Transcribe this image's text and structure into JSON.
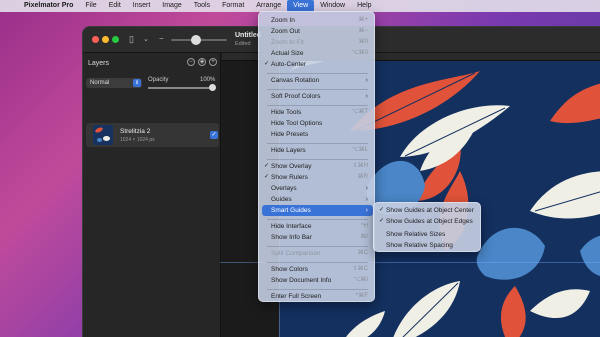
{
  "menubar": {
    "items": [
      "Pixelmator Pro",
      "File",
      "Edit",
      "Insert",
      "Image",
      "Tools",
      "Format",
      "Arrange",
      "View",
      "Window",
      "Help"
    ],
    "active": "View"
  },
  "window": {
    "doc_title": "Untitled",
    "doc_subtitle": "Edited"
  },
  "layers_panel": {
    "title": "Layers",
    "blend_mode": "Normal",
    "opacity_label": "Opacity",
    "opacity_value": "100%",
    "layer": {
      "name": "Strelitzia 2",
      "size": "1024 × 1024 px",
      "visible": true
    }
  },
  "view_menu": {
    "zoom_in": {
      "label": "Zoom In",
      "shortcut": "⌘+"
    },
    "zoom_out": {
      "label": "Zoom Out",
      "shortcut": "⌘−"
    },
    "zoom_to_fit": {
      "label": "Zoom to Fit",
      "shortcut": "⌘0"
    },
    "actual_size": {
      "label": "Actual Size",
      "shortcut": "⌥⌘0"
    },
    "auto_center": {
      "label": "Auto-Center",
      "checked": true
    },
    "canvas_rotation": {
      "label": "Canvas Rotation"
    },
    "soft_proof_colors": {
      "label": "Soft Proof Colors"
    },
    "hide_tools": {
      "label": "Hide Tools",
      "shortcut": "⌥⌘T"
    },
    "hide_tool_options": {
      "label": "Hide Tool Options"
    },
    "hide_presets": {
      "label": "Hide Presets"
    },
    "hide_layers": {
      "label": "Hide Layers",
      "shortcut": "⌥⌘L"
    },
    "show_overlay": {
      "label": "Show Overlay",
      "shortcut": "⇧⌘H",
      "checked": true
    },
    "show_rulers": {
      "label": "Show Rulers",
      "shortcut": "⌘R",
      "checked": true
    },
    "overlays": {
      "label": "Overlays"
    },
    "guides": {
      "label": "Guides"
    },
    "smart_guides": {
      "label": "Smart Guides",
      "highlighted": true
    },
    "hide_interface": {
      "label": "Hide Interface",
      "shortcut": "^H"
    },
    "show_info_bar": {
      "label": "Show Info Bar",
      "shortcut": "⌘/"
    },
    "split_comparison": {
      "label": "Split Comparison",
      "shortcut": "⌘C"
    },
    "show_colors": {
      "label": "Show Colors",
      "shortcut": "⇧⌘C"
    },
    "show_document_info": {
      "label": "Show Document Info",
      "shortcut": "⌥⌘I"
    },
    "enter_full_screen": {
      "label": "Enter Full Screen",
      "shortcut": "^⌘F"
    }
  },
  "smart_guides_submenu": {
    "items": [
      {
        "label": "Show Guides at Object Center",
        "checked": true
      },
      {
        "label": "Show Guides at Object Edges",
        "checked": true
      },
      {
        "label": "Show Relative Sizes",
        "checked": false
      },
      {
        "label": "Show Relative Spacing",
        "checked": false
      }
    ]
  },
  "colors": {
    "accent": "#3a73d8",
    "artwork_bg": "#13305f",
    "leaf_red": "#e0533a",
    "leaf_cream": "#f0efe6",
    "leaf_blue": "#4a86c8"
  }
}
